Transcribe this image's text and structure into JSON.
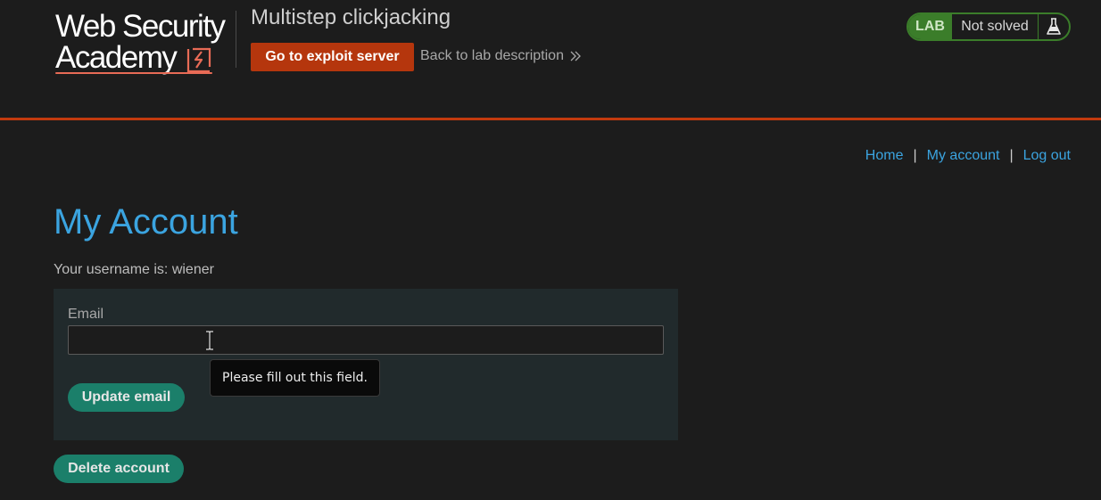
{
  "header": {
    "logo": {
      "line1": "Web Security",
      "line2": "Academy"
    },
    "lab_title": "Multistep clickjacking",
    "exploit_button": "Go to exploit server",
    "back_link": "Back to lab description",
    "status": {
      "badge": "LAB",
      "text": "Not solved",
      "icon": "flask-icon"
    }
  },
  "nav": {
    "items": [
      {
        "label": "Home"
      },
      {
        "label": "My account"
      },
      {
        "label": "Log out"
      }
    ],
    "separator": "|"
  },
  "main": {
    "title": "My Account",
    "username_line": "Your username is: wiener",
    "email_form": {
      "label": "Email",
      "value": "",
      "tooltip": "Please fill out this field.",
      "submit": "Update email"
    },
    "delete_button": "Delete account"
  },
  "colors": {
    "background": "#1c1c1c",
    "accent_orange": "#c23a0e",
    "link_blue": "#3ba4e0",
    "button_teal": "#1b7f6a",
    "status_green": "#3b7d2a"
  }
}
